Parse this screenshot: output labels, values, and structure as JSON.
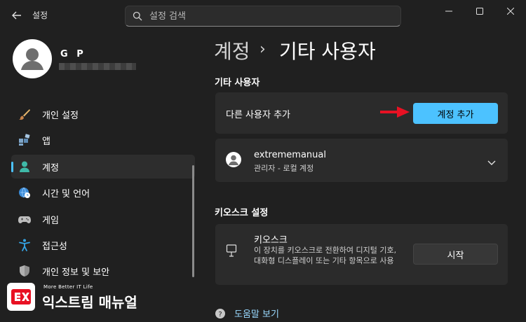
{
  "titlebar": {
    "app_title": "설정",
    "search_placeholder": "설정 검색"
  },
  "profile": {
    "name": "G P"
  },
  "sidebar": {
    "items": [
      {
        "label": "개인 설정",
        "icon": "brush-icon"
      },
      {
        "label": "앱",
        "icon": "apps-icon"
      },
      {
        "label": "계정",
        "icon": "person-icon",
        "selected": true
      },
      {
        "label": "시간 및 언어",
        "icon": "globe-clock-icon"
      },
      {
        "label": "게임",
        "icon": "gamepad-icon"
      },
      {
        "label": "접근성",
        "icon": "accessibility-icon"
      },
      {
        "label": "개인 정보 및 보안",
        "icon": "shield-icon"
      }
    ]
  },
  "breadcrumb": {
    "parent": "계정",
    "separator": "›",
    "current": "기타 사용자"
  },
  "other_users": {
    "section_title": "기타 사용자",
    "add_label": "다른 사용자 추가",
    "add_button": "계정 추가",
    "account": {
      "name": "extrememanual",
      "type": "관리자 - 로컬 계정"
    }
  },
  "kiosk": {
    "section_title": "키오스크 설정",
    "title": "키오스크",
    "description": "이 장치를 키오스크로 전환하여 디지털 기호, 대화형 디스플레이 또는 기타 항목으로 사용",
    "start_button": "시작"
  },
  "help": {
    "label": "도움말 보기"
  },
  "watermark": {
    "tagline": "More Better IT Life",
    "title": "익스트림 매뉴얼"
  },
  "colors": {
    "accent": "#4cc2ff",
    "background": "#202020",
    "card": "#2b2b2b",
    "arrow": "#e81123"
  }
}
